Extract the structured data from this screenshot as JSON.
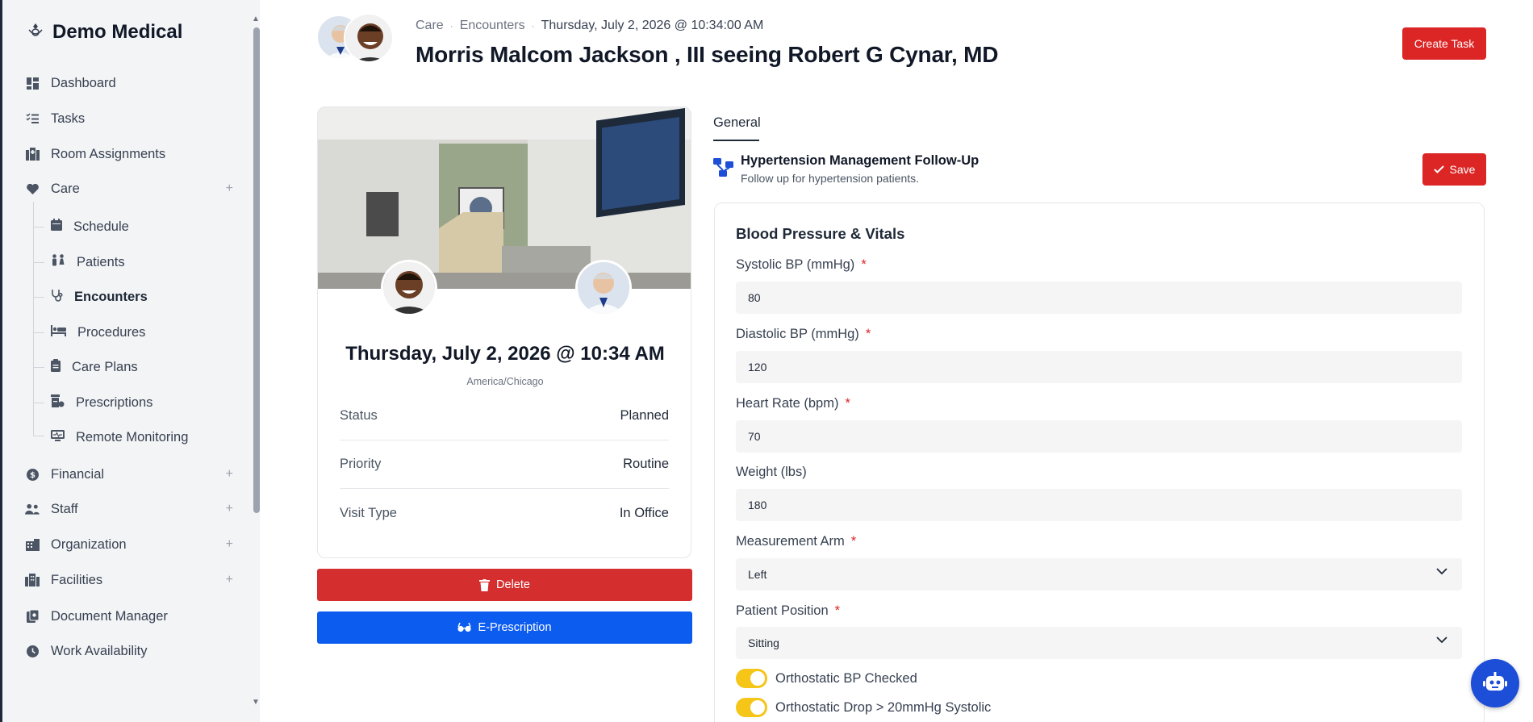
{
  "sidebar": {
    "brand": "Demo Medical",
    "logo_text": "DEMO",
    "items": [
      {
        "label": "Dashboard"
      },
      {
        "label": "Tasks"
      },
      {
        "label": "Room Assignments"
      },
      {
        "label": "Care"
      },
      {
        "label": "Financial"
      },
      {
        "label": "Staff"
      },
      {
        "label": "Organization"
      },
      {
        "label": "Facilities"
      },
      {
        "label": "Document Manager"
      },
      {
        "label": "Work Availability"
      }
    ],
    "care_sub": [
      {
        "label": "Schedule"
      },
      {
        "label": "Patients"
      },
      {
        "label": "Encounters"
      },
      {
        "label": "Procedures"
      },
      {
        "label": "Care Plans"
      },
      {
        "label": "Prescriptions"
      },
      {
        "label": "Remote Monitoring"
      }
    ]
  },
  "header": {
    "crumb_1": "Care",
    "crumb_2": "Encounters",
    "crumb_date": "Thursday, July 2, 2026 @ 10:34:00 AM",
    "title": "Morris Malcom Jackson , III seeing Robert G Cynar, MD",
    "create_task": "Create Task"
  },
  "encounter": {
    "date": "Thursday, July 2, 2026 @ 10:34 AM",
    "timezone": "America/Chicago",
    "details": [
      {
        "key": "Status",
        "value": "Planned"
      },
      {
        "key": "Priority",
        "value": "Routine"
      },
      {
        "key": "Visit Type",
        "value": "In Office"
      }
    ],
    "delete_label": "Delete",
    "erx_label": "E-Prescription"
  },
  "form": {
    "tab": "General",
    "title": "Hypertension Management Follow-Up",
    "subtitle": "Follow up for hypertension patients.",
    "save_label": "Save",
    "section": "Blood Pressure & Vitals",
    "fields": [
      {
        "label": "Systolic BP (mmHg)",
        "required": "*",
        "value": "80"
      },
      {
        "label": "Diastolic BP (mmHg)",
        "required": "*",
        "value": "120"
      },
      {
        "label": "Heart Rate (bpm)",
        "required": "*",
        "value": "70"
      },
      {
        "label": "Weight (lbs)",
        "required": "",
        "value": "180"
      },
      {
        "label": "Measurement Arm",
        "required": "*",
        "value": "Left"
      },
      {
        "label": "Patient Position",
        "required": "*",
        "value": "Sitting"
      }
    ],
    "toggles": [
      {
        "label": "Orthostatic BP Checked",
        "checked": true
      },
      {
        "label": "Orthostatic Drop > 20mmHg Systolic",
        "checked": true
      }
    ]
  },
  "colors": {
    "danger": "#dc2626",
    "primary": "#0d5cf0",
    "toggle": "#f5c518",
    "chat": "#1d4ed8"
  }
}
